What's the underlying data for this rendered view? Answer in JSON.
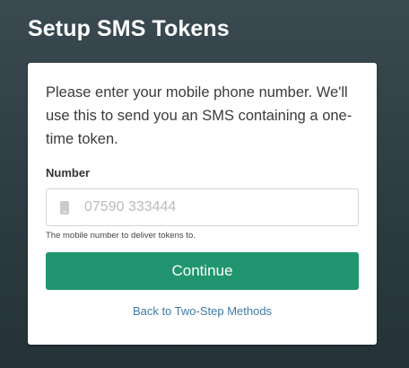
{
  "header": {
    "title": "Setup SMS Tokens"
  },
  "card": {
    "intro": "Please enter your mobile phone number. We'll use this to send you an SMS containing a one-time token.",
    "number_label": "Number",
    "number_input": {
      "value": "",
      "placeholder": "07590 333444",
      "icon": "mobile-phone-icon"
    },
    "help_text": "The mobile number to deliver tokens to.",
    "continue_label": "Continue",
    "back_link": "Back to Two-Step Methods"
  },
  "colors": {
    "background": "#2c3c42",
    "primary_button": "#21956f",
    "link": "#3f7aa8"
  }
}
